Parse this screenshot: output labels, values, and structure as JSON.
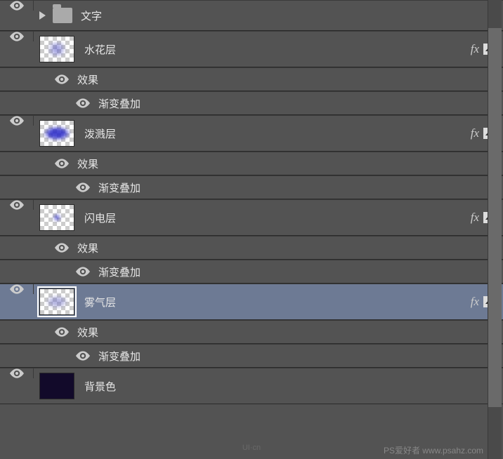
{
  "folder": {
    "name": "文字"
  },
  "layers": [
    {
      "id": "splash",
      "name": "水花层",
      "thumb": "splash",
      "selected": false,
      "fx": true,
      "effects": {
        "label": "效果",
        "items": [
          "渐变叠加"
        ]
      }
    },
    {
      "id": "spatter",
      "name": "泼溅层",
      "thumb": "splash2",
      "selected": false,
      "fx": true,
      "effects": {
        "label": "效果",
        "items": [
          "渐变叠加"
        ]
      }
    },
    {
      "id": "lightning",
      "name": "闪电层",
      "thumb": "light",
      "selected": false,
      "fx": true,
      "effects": {
        "label": "效果",
        "items": [
          "渐变叠加"
        ]
      }
    },
    {
      "id": "fog",
      "name": "雾气层",
      "thumb": "fog",
      "selected": true,
      "fx": true,
      "effects": {
        "label": "效果",
        "items": [
          "渐变叠加"
        ]
      }
    },
    {
      "id": "bgcolor",
      "name": "背景色",
      "thumb": "solid",
      "selected": false,
      "fx": false
    }
  ],
  "fx_symbol": "fx",
  "watermarks": {
    "ui": "UI·cn",
    "ps": "PS爱好者 www.psahz.com"
  }
}
